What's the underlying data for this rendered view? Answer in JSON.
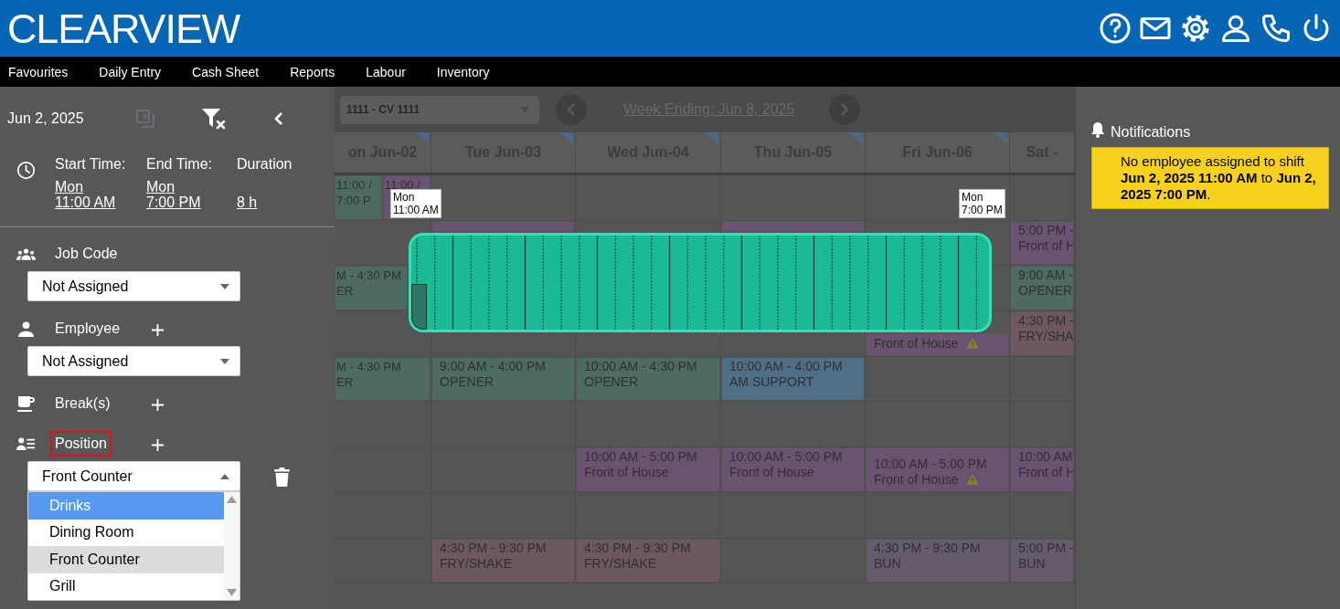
{
  "app": {
    "logo": "CLEARVIEW"
  },
  "nav": [
    "Favourites",
    "Daily Entry",
    "Cash Sheet",
    "Reports",
    "Labour",
    "Inventory"
  ],
  "shift_editor": {
    "date": "Jun 2, 2025",
    "copy_disabled": true,
    "times": [
      {
        "label": "Start Time:",
        "day": "Mon",
        "time": "11:00 AM"
      },
      {
        "label": "End Time:",
        "day": "Mon",
        "time": "7:00 PM"
      },
      {
        "label": "Duration",
        "time": "8 h"
      }
    ],
    "fields": [
      {
        "kind": "job",
        "label": "Job Code",
        "addable": false,
        "highlighted": false,
        "value": "Not Assigned",
        "expanded": false
      },
      {
        "kind": "employee",
        "label": "Employee",
        "addable": true,
        "highlighted": false,
        "value": "Not Assigned",
        "expanded": false
      },
      {
        "kind": "breaks",
        "label": "Break(s)",
        "addable": true,
        "highlighted": false
      },
      {
        "kind": "position",
        "label": "Position",
        "addable": true,
        "highlighted": true,
        "value": "Front Counter",
        "expanded": true,
        "deletable": true,
        "options": [
          {
            "label": "Drinks",
            "focused": true,
            "selected": false
          },
          {
            "label": "Dining Room",
            "focused": false,
            "selected": false
          },
          {
            "label": "Front Counter",
            "focused": false,
            "selected": true
          },
          {
            "label": "Grill",
            "focused": false,
            "selected": false
          }
        ]
      }
    ]
  },
  "schedule": {
    "location": "1111 - CV 1111",
    "week_ending": "Week Ending: Jun 8, 2025",
    "days": [
      {
        "label": "on Jun-02",
        "flagged": true
      },
      {
        "label": "Tue Jun-03",
        "flagged": true
      },
      {
        "label": "Wed Jun-04",
        "flagged": true
      },
      {
        "label": "Thu Jun-05",
        "flagged": true
      },
      {
        "label": "Fri Jun-06",
        "flagged": true
      },
      {
        "label": "Sat -",
        "flagged": false
      }
    ],
    "rows": [
      {
        "cells": [
          {
            "shifts": [
              {
                "kind": "shift",
                "lines": [
                  "11:00 /",
                  "7:00 P"
                ],
                "color": "#4d6b63"
              },
              {
                "kind": "shift",
                "lines": [
                  "11:00 /"
                ],
                "color": "#6a5370"
              }
            ]
          },
          {},
          {},
          {},
          {},
          {}
        ]
      },
      {
        "cells": [
          {},
          {
            "shifts": [
              {
                "kind": "shift",
                "color": "#6a5370"
              }
            ]
          },
          {},
          {
            "shifts": [
              {
                "kind": "shift",
                "color": "#6a5370"
              }
            ]
          },
          {},
          {
            "shifts": [
              {
                "kind": "shift",
                "lines": [
                  "5:00 PM -",
                  "Front of H"
                ],
                "color": "#6a5370"
              }
            ]
          }
        ]
      },
      {
        "cells": [
          {
            "shifts": [
              {
                "kind": "shift",
                "lines": [
                  "M - 4:30 PM",
                  "ER"
                ],
                "color": "#4d6b63"
              }
            ]
          },
          {},
          {},
          {},
          {},
          {
            "shifts": [
              {
                "kind": "shift",
                "lines": [
                  "9:00 AM -",
                  "OPENER"
                ],
                "color": "#4d6b63"
              }
            ]
          }
        ]
      },
      {
        "cells": [
          {},
          {},
          {},
          {},
          {
            "shifts": [
              {
                "kind": "warning",
                "lines": [
                  "Front of House"
                ],
                "color": "#6a5370"
              }
            ]
          },
          {
            "shifts": [
              {
                "kind": "shift",
                "lines": [
                  "4:30 PM -",
                  "FRY/SHA"
                ],
                "color": "#6d585f"
              }
            ]
          }
        ]
      },
      {
        "cells": [
          {
            "shifts": [
              {
                "kind": "shift",
                "lines": [
                  "M - 4:30 PM",
                  "ER"
                ],
                "color": "#4d6b63"
              }
            ]
          },
          {
            "shifts": [
              {
                "kind": "shift",
                "lines": [
                  "9:00 AM - 4:00 PM",
                  "OPENER"
                ],
                "color": "#4d6b63"
              }
            ]
          },
          {
            "shifts": [
              {
                "kind": "shift",
                "lines": [
                  "10:00 AM - 4:30 PM",
                  "OPENER"
                ],
                "color": "#4d6b63"
              }
            ]
          },
          {
            "shifts": [
              {
                "kind": "shift",
                "lines": [
                  "10:00 AM - 4:00 PM",
                  "AM SUPPORT"
                ],
                "color": "#4f6e87"
              }
            ]
          },
          {},
          {}
        ]
      },
      {
        "cells": [
          {},
          {},
          {},
          {},
          {},
          {}
        ]
      },
      {
        "cells": [
          {},
          {},
          {
            "shifts": [
              {
                "kind": "shift",
                "lines": [
                  "10:00 AM - 5:00 PM",
                  "Front of House"
                ],
                "color": "#6a5370"
              }
            ]
          },
          {
            "shifts": [
              {
                "kind": "shift",
                "lines": [
                  "10:00 AM - 5:00 PM",
                  "Front of House"
                ],
                "color": "#6a5370"
              }
            ]
          },
          {
            "shifts": [
              {
                "kind": "warning",
                "lines": [
                  "10:00 AM - 5:00 PM",
                  "Front of House"
                ],
                "color": "#6a5370"
              }
            ]
          },
          {
            "shifts": [
              {
                "kind": "shift",
                "lines": [
                  "10:00 AM",
                  "Front of H"
                ],
                "color": "#6a5370"
              }
            ]
          }
        ]
      },
      {
        "cells": [
          {},
          {},
          {},
          {},
          {},
          {}
        ]
      },
      {
        "cells": [
          {},
          {
            "shifts": [
              {
                "kind": "shift",
                "lines": [
                  "4:30 PM - 9:30 PM",
                  "FRY/SHAKE"
                ],
                "color": "#6d585f"
              }
            ]
          },
          {
            "shifts": [
              {
                "kind": "shift",
                "lines": [
                  "4:30 PM - 9:30 PM",
                  "FRY/SHAKE"
                ],
                "color": "#6d585f"
              }
            ]
          },
          {},
          {
            "shifts": [
              {
                "kind": "shift",
                "lines": [
                  "4:30 PM - 9:30 PM",
                  "BUN"
                ],
                "color": "#665b6d"
              }
            ]
          },
          {
            "shifts": [
              {
                "kind": "shift",
                "lines": [
                  "5:00 PM -",
                  "BUN"
                ],
                "color": "#665b6d"
              }
            ]
          }
        ]
      }
    ],
    "selection": {
      "start_tip": [
        "Mon",
        "11:00 AM"
      ],
      "end_tip": [
        "Mon",
        "7:00 PM"
      ]
    }
  },
  "notifications": {
    "title": "Notifications",
    "items": [
      {
        "text": "No employee assigned to shift **Jun 2, 2025 11:00 AM** to **Jun 2, 2025 7:00 PM**."
      }
    ]
  }
}
